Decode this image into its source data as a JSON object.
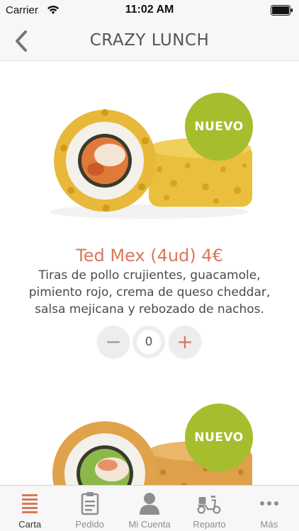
{
  "status_bar": {
    "carrier": "Carrier",
    "time": "11:02 AM"
  },
  "nav": {
    "title": "CRAZY LUNCH",
    "back_icon": "chevron-left-icon"
  },
  "products": [
    {
      "badge": "NUEVO",
      "name": "Ted Mex (4ud) 4€",
      "description": "Tiras de pollo crujientes, guacamole, pimiento rojo, crema de queso cheddar, salsa mejicana y rebozado de nachos.",
      "quantity": "0",
      "minus_label": "−",
      "plus_label": "+"
    },
    {
      "badge": "NUEVO"
    }
  ],
  "tabs": [
    {
      "label": "Carta",
      "icon": "menu-list-icon",
      "active": true
    },
    {
      "label": "Pedido",
      "icon": "clipboard-icon",
      "active": false
    },
    {
      "label": "Mi Cuenta",
      "icon": "user-icon",
      "active": false
    },
    {
      "label": "Reparto",
      "icon": "scooter-icon",
      "active": false
    },
    {
      "label": "Más",
      "icon": "more-icon",
      "active": false
    }
  ],
  "colors": {
    "accent": "#d9775c",
    "badge": "#a6bd2e",
    "tab_active": "#d9775c",
    "tab_inactive": "#8e8e8e"
  }
}
